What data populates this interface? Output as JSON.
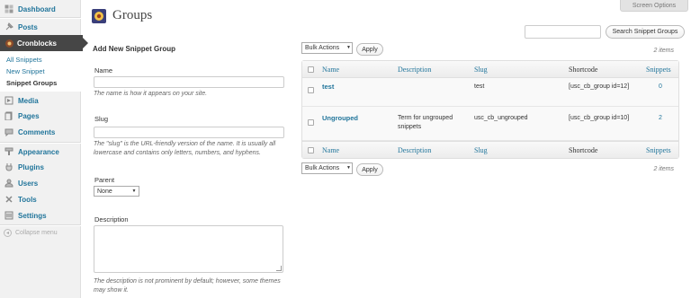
{
  "sidebar": {
    "dashboard": "Dashboard",
    "posts": "Posts",
    "cronblocks": "Cronblocks",
    "submenu": [
      "All Snippets",
      "New Snippet",
      "Snippet Groups"
    ],
    "media": "Media",
    "pages": "Pages",
    "comments": "Comments",
    "appearance": "Appearance",
    "plugins": "Plugins",
    "users": "Users",
    "tools": "Tools",
    "settings": "Settings",
    "collapse": "Collapse menu"
  },
  "header": {
    "title": "Groups",
    "screen_options": "Screen Options",
    "search_placeholder": "",
    "search_button": "Search Snippet Groups"
  },
  "form": {
    "heading": "Add New Snippet Group",
    "name_label": "Name",
    "name_value": "",
    "name_help": "The name is how it appears on your site.",
    "slug_label": "Slug",
    "slug_value": "",
    "slug_help": "The \"slug\" is the URL-friendly version of the name. It is usually all lowercase and contains only letters, numbers, and hyphens.",
    "parent_label": "Parent",
    "parent_value": "None",
    "description_label": "Description",
    "description_help": "The description is not prominent by default; however, some themes may show it."
  },
  "list": {
    "bulk_actions": "Bulk Actions",
    "apply": "Apply",
    "items_count": "2 items",
    "columns": [
      "Name",
      "Description",
      "Slug",
      "Shortcode",
      "Snippets"
    ],
    "rows": [
      {
        "name": "test",
        "description": "",
        "slug": "test",
        "shortcode": "[usc_cb_group id=12]",
        "snippets": "0"
      },
      {
        "name": "Ungrouped",
        "description": "Term for ungrouped snippets",
        "slug": "usc_cb_ungrouped",
        "shortcode": "[usc_cb_group id=10]",
        "snippets": "2"
      }
    ]
  },
  "colors": {
    "link": "#21759b",
    "menu_active_bg": "#464646",
    "sidebar_bg": "#f1f1f1"
  }
}
